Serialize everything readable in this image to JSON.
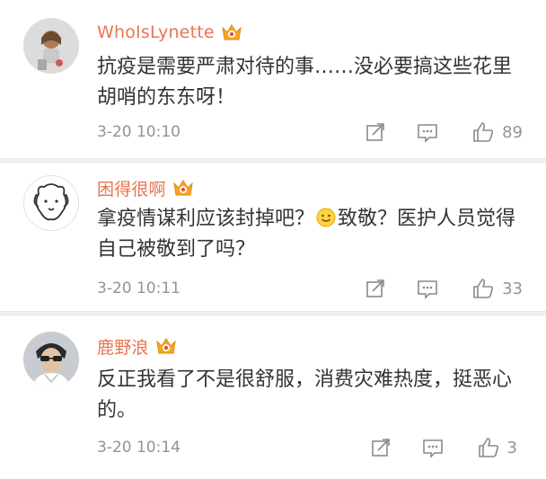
{
  "colors": {
    "username": "#eb7350",
    "text": "#333333",
    "meta": "#939393",
    "divider": "#f2f2f2",
    "vip_badge": "#f5a623"
  },
  "comments": [
    {
      "username": "WhoIsLynette",
      "text": "抗疫是需要严肃对待的事……没必要搞这些花里胡哨的东东呀！",
      "timestamp": "3-20 10:10",
      "likes": "89",
      "avatar": "avatar-photo"
    },
    {
      "username": "困得很啊",
      "text_before": "拿疫情谋利应该封掉吧？",
      "emoji": "smile-emoji",
      "text_after": "致敬？医护人员觉得自己被敬到了吗？",
      "timestamp": "3-20 10:11",
      "likes": "33",
      "avatar": "cartoon-dog-avatar"
    },
    {
      "username": "鹿野浪",
      "text": "反正我看了不是很舒服，消费灾难热度，挺恶心的。",
      "timestamp": "3-20 10:14",
      "likes": "3",
      "avatar": "avatar-photo"
    }
  ],
  "icons": {
    "forward": "forward-icon",
    "comment": "comment-icon",
    "like": "thumbs-up-icon",
    "badge": "vip-crown-icon"
  }
}
